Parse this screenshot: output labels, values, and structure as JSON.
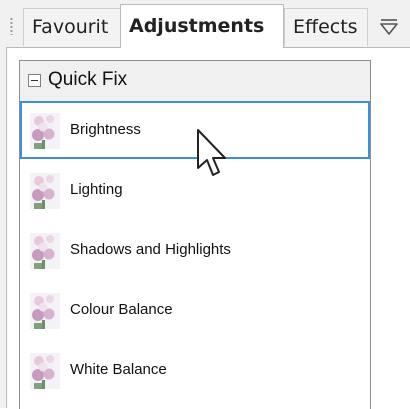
{
  "tabs": {
    "favourites": "Favourit",
    "adjustments": "Adjustments",
    "effects": "Effects"
  },
  "group": {
    "title": "Quick Fix",
    "expanded": true
  },
  "items": [
    {
      "label": "Brightness",
      "selected": true
    },
    {
      "label": "Lighting",
      "selected": false
    },
    {
      "label": "Shadows and Highlights",
      "selected": false
    },
    {
      "label": "Colour Balance",
      "selected": false
    },
    {
      "label": "White Balance",
      "selected": false
    }
  ],
  "icons": {
    "tab_menu": "tab-menu-icon",
    "collapse": "minus-box-icon",
    "thumbnail": "flower-thumbnail-icon",
    "scroll_up": "scroll-up-arrow-icon",
    "cursor": "mouse-pointer-icon"
  },
  "colors": {
    "selection_border": "#3d8ee0",
    "panel_background": "#f2f2f2"
  }
}
